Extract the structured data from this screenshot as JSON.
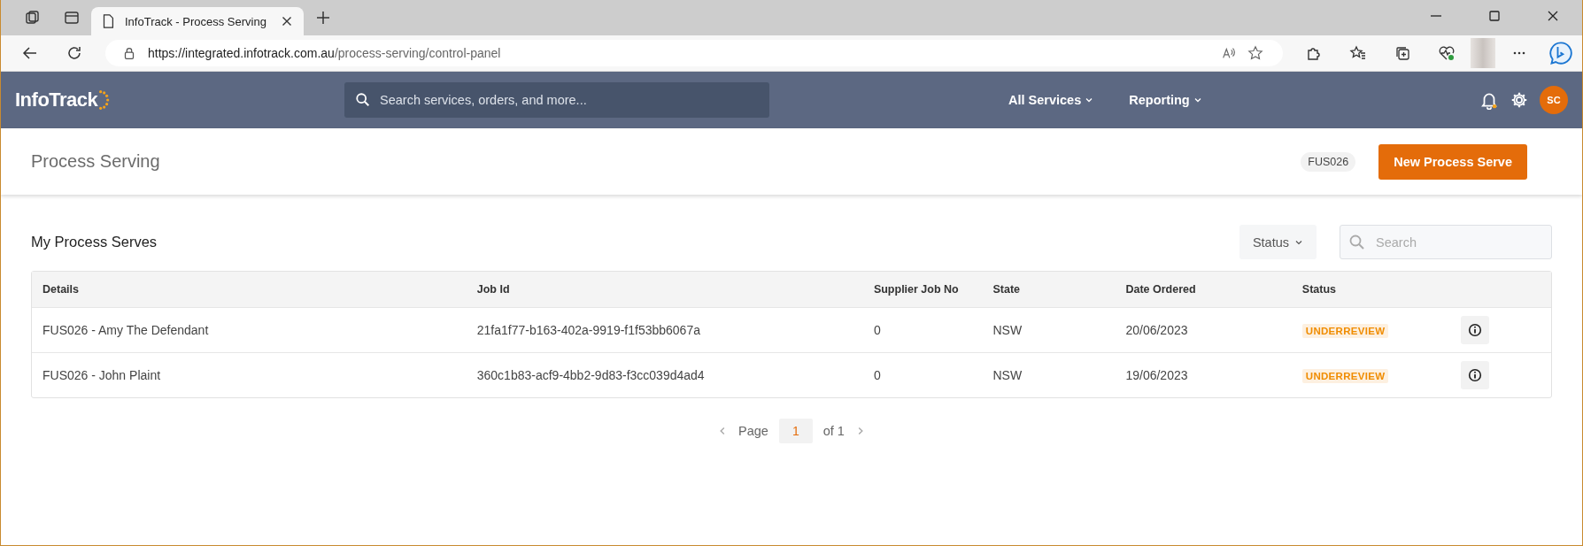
{
  "browser": {
    "tab_title": "InfoTrack - Process Serving",
    "url_host": "https://integrated.infotrack.com.au",
    "url_path": "/process-serving/control-panel"
  },
  "header": {
    "logo": "InfoTrack",
    "search_placeholder": "Search services, orders, and more...",
    "nav": [
      "All Services",
      "Reporting"
    ],
    "avatar": "SC"
  },
  "page": {
    "title": "Process Serving",
    "account_code": "FUS026",
    "new_button": "New Process Serve"
  },
  "section": {
    "title": "My Process Serves",
    "status_filter": "Status",
    "search_placeholder": "Search"
  },
  "table": {
    "columns": [
      "Details",
      "Job Id",
      "Supplier Job No",
      "State",
      "Date Ordered",
      "Status"
    ],
    "rows": [
      {
        "details": "FUS026 - Amy The Defendant",
        "job_id": "21fa1f77-b163-402a-9919-f1f53bb6067a",
        "supplier_job_no": "0",
        "state": "NSW",
        "date_ordered": "20/06/2023",
        "status": "UNDERREVIEW"
      },
      {
        "details": "FUS026 - John Plaint",
        "job_id": "360c1b83-acf9-4bb2-9d83-f3cc039d4ad4",
        "supplier_job_no": "0",
        "state": "NSW",
        "date_ordered": "19/06/2023",
        "status": "UNDERREVIEW"
      }
    ]
  },
  "pagination": {
    "label": "Page",
    "current": "1",
    "of": "of 1"
  }
}
